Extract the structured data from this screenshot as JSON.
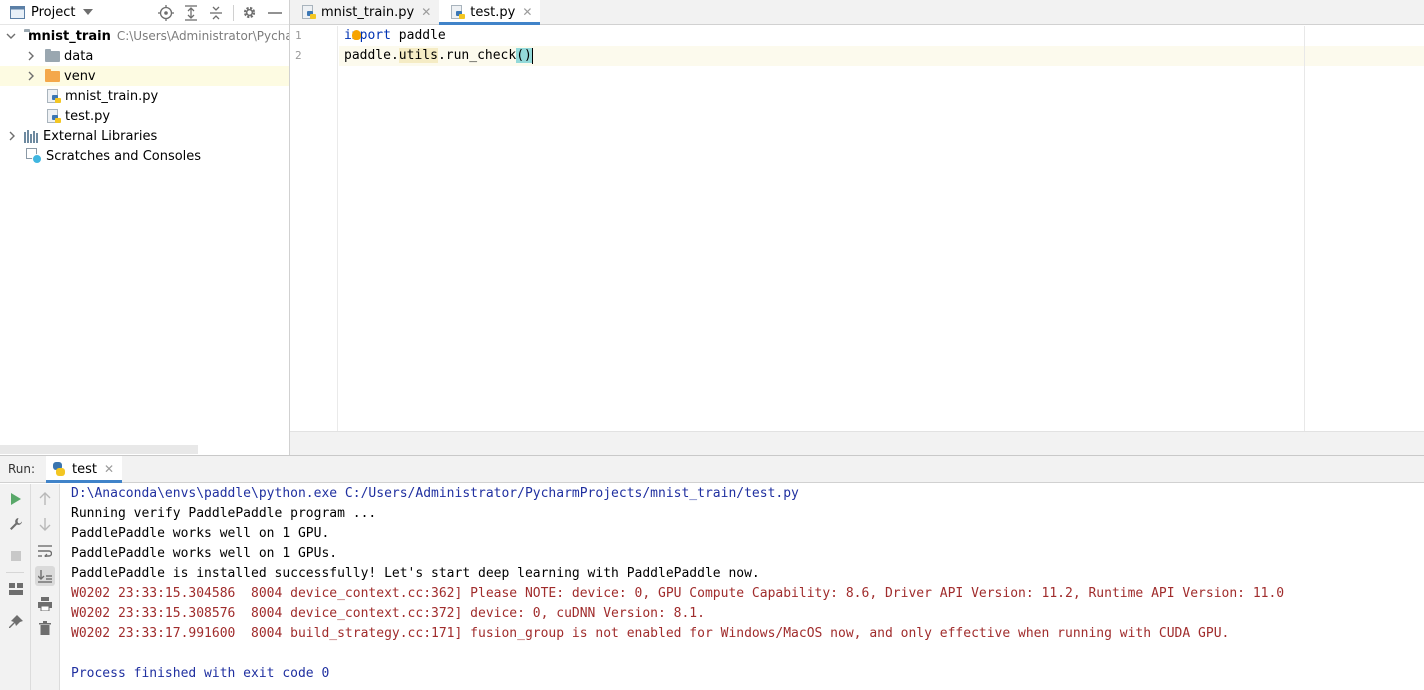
{
  "project_panel": {
    "title": "Project",
    "tree": {
      "root_name": "mnist_train",
      "root_path": "C:\\Users\\Administrator\\PycharmProjects\\mnist_train",
      "items": [
        {
          "label": "data"
        },
        {
          "label": "venv"
        },
        {
          "label": "mnist_train.py"
        },
        {
          "label": "test.py"
        }
      ],
      "external_libraries": "External Libraries",
      "scratches": "Scratches and Consoles"
    }
  },
  "editor": {
    "tabs": [
      {
        "label": "mnist_train.py",
        "active": false
      },
      {
        "label": "test.py",
        "active": true
      }
    ],
    "lines": [
      {
        "num": "1",
        "kw": "import",
        "rest": " paddle"
      },
      {
        "num": "2",
        "pre": "paddle.",
        "mod": "utils",
        "mid": ".run_check",
        "paren": "()"
      }
    ]
  },
  "run_panel": {
    "title": "Run:",
    "tab_label": "test",
    "console": [
      {
        "text": "D:\\Anaconda\\envs\\paddle\\python.exe C:/Users/Administrator/PycharmProjects/mnist_train/test.py",
        "style": "blue"
      },
      {
        "text": "Running verify PaddlePaddle program ...",
        "style": "black"
      },
      {
        "text": "PaddlePaddle works well on 1 GPU.",
        "style": "black"
      },
      {
        "text": "PaddlePaddle works well on 1 GPUs.",
        "style": "black"
      },
      {
        "text": "PaddlePaddle is installed successfully! Let's start deep learning with PaddlePaddle now.",
        "style": "black"
      },
      {
        "text": "W0202 23:33:15.304586  8004 device_context.cc:362] Please NOTE: device: 0, GPU Compute Capability: 8.6, Driver API Version: 11.2, Runtime API Version: 11.0",
        "style": "red"
      },
      {
        "text": "W0202 23:33:15.308576  8004 device_context.cc:372] device: 0, cuDNN Version: 8.1.",
        "style": "red"
      },
      {
        "text": "W0202 23:33:17.991600  8004 build_strategy.cc:171] fusion_group is not enabled for Windows/MacOS now, and only effective when running with CUDA GPU.",
        "style": "red"
      },
      {
        "text": "",
        "style": "black"
      },
      {
        "text": "Process finished with exit code 0",
        "style": "blue"
      }
    ]
  },
  "colors": {
    "accent": "#4083c9",
    "keyword": "#0033b3",
    "console_red": "#a02c2c",
    "console_blue": "#2030a0",
    "selection": "#fdfbe2"
  },
  "icons": [
    "project-view-icon",
    "locate-icon",
    "expand-all-icon",
    "collapse-all-icon",
    "gear-icon",
    "hide-icon",
    "folder-icon",
    "python-file-icon",
    "libraries-icon",
    "scratches-icon",
    "run-icon",
    "wrench-icon",
    "stop-icon",
    "layout-icon",
    "pin-icon",
    "up-arrow-icon",
    "down-arrow-icon",
    "soft-wrap-icon",
    "scroll-to-end-icon",
    "print-icon",
    "trash-icon"
  ]
}
